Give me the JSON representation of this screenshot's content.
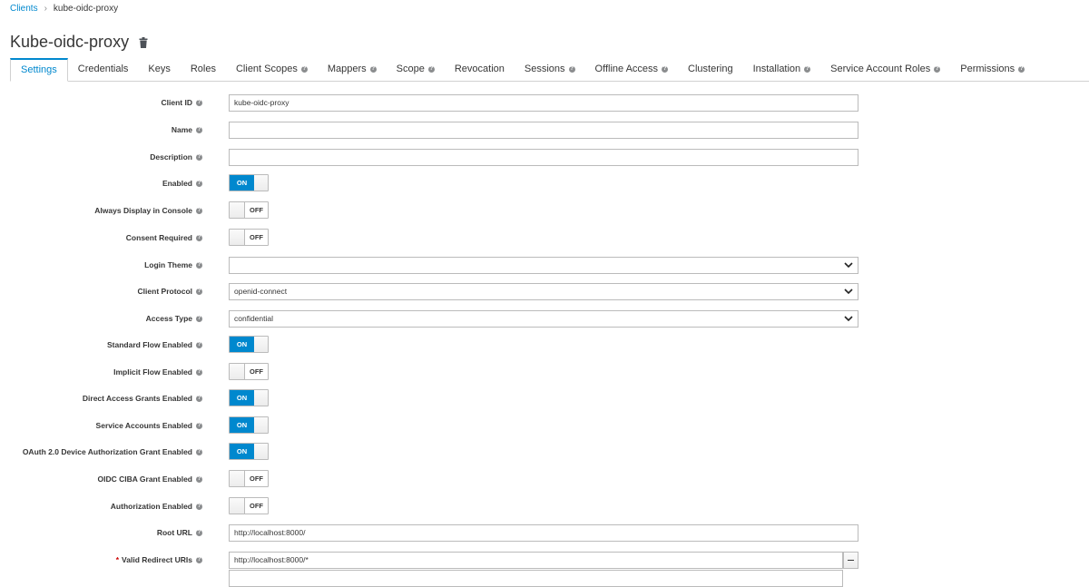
{
  "breadcrumb": {
    "parent": "Clients",
    "current": "kube-oidc-proxy"
  },
  "page": {
    "title": "Kube-oidc-proxy"
  },
  "tabs": [
    {
      "label": "Settings",
      "help": false,
      "active": true
    },
    {
      "label": "Credentials",
      "help": false
    },
    {
      "label": "Keys",
      "help": false
    },
    {
      "label": "Roles",
      "help": false
    },
    {
      "label": "Client Scopes",
      "help": true
    },
    {
      "label": "Mappers",
      "help": true
    },
    {
      "label": "Scope",
      "help": true
    },
    {
      "label": "Revocation",
      "help": false
    },
    {
      "label": "Sessions",
      "help": true
    },
    {
      "label": "Offline Access",
      "help": true
    },
    {
      "label": "Clustering",
      "help": false
    },
    {
      "label": "Installation",
      "help": true
    },
    {
      "label": "Service Account Roles",
      "help": true
    },
    {
      "label": "Permissions",
      "help": true
    }
  ],
  "form": {
    "client_id": {
      "label": "Client ID",
      "value": "kube-oidc-proxy"
    },
    "name": {
      "label": "Name",
      "value": ""
    },
    "description": {
      "label": "Description",
      "value": ""
    },
    "enabled": {
      "label": "Enabled",
      "state": "ON"
    },
    "always_display": {
      "label": "Always Display in Console",
      "state": "OFF"
    },
    "consent_required": {
      "label": "Consent Required",
      "state": "OFF"
    },
    "login_theme": {
      "label": "Login Theme",
      "value": ""
    },
    "client_protocol": {
      "label": "Client Protocol",
      "value": "openid-connect"
    },
    "access_type": {
      "label": "Access Type",
      "value": "confidential"
    },
    "standard_flow": {
      "label": "Standard Flow Enabled",
      "state": "ON"
    },
    "implicit_flow": {
      "label": "Implicit Flow Enabled",
      "state": "OFF"
    },
    "direct_access": {
      "label": "Direct Access Grants Enabled",
      "state": "ON"
    },
    "service_accounts": {
      "label": "Service Accounts Enabled",
      "state": "ON"
    },
    "device_grant": {
      "label": "OAuth 2.0 Device Authorization Grant Enabled",
      "state": "ON"
    },
    "ciba_grant": {
      "label": "OIDC CIBA Grant Enabled",
      "state": "OFF"
    },
    "authorization": {
      "label": "Authorization Enabled",
      "state": "OFF"
    },
    "root_url": {
      "label": "Root URL",
      "value": "http://localhost:8000/"
    },
    "redirect_uris": {
      "label": "Valid Redirect URIs",
      "required_mark": "*",
      "value": "http://localhost:8000/*"
    }
  },
  "colors": {
    "accent": "#0088ce",
    "required": "#cc0000",
    "border": "#bbbbbb"
  },
  "icons": {
    "trash": "trash-icon",
    "help": "help-circle-icon",
    "chevron": "chevron-down-icon",
    "minus": "minus-icon"
  }
}
